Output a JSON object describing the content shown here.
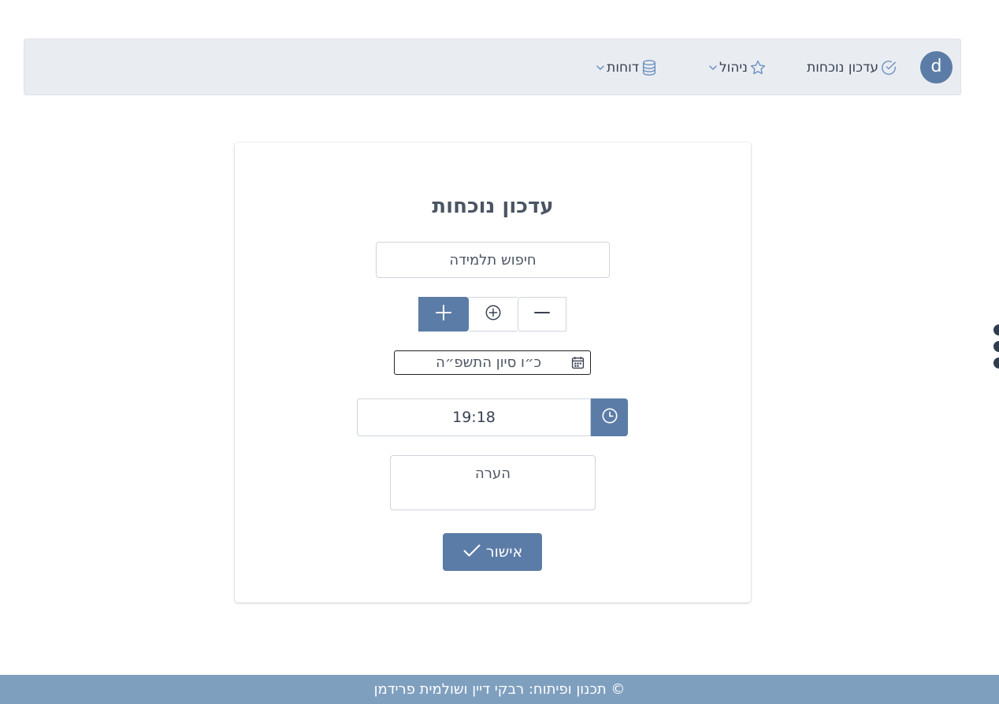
{
  "navbar": {
    "avatar_letter": "d",
    "items": [
      {
        "label": "עדכון נוכחות",
        "icon": "check-circle-icon",
        "has_dropdown": false
      },
      {
        "label": "ניהול",
        "icon": "star-icon",
        "has_dropdown": true
      },
      {
        "label": "דוחות",
        "icon": "database-icon",
        "has_dropdown": true
      }
    ]
  },
  "form": {
    "title": "עדכון נוכחות",
    "search_placeholder": "חיפוש תלמידה",
    "status_buttons": [
      {
        "icon": "plus-icon",
        "active": true
      },
      {
        "icon": "plus-circle-icon",
        "active": false
      },
      {
        "icon": "minus-icon",
        "active": false
      }
    ],
    "date_value": "כ״ו סיון התשפ״ה",
    "time_value": "19:18",
    "note_placeholder": "הערה",
    "confirm_label": "אישור"
  },
  "footer": {
    "text": "© תכנון ופיתוח: רבקי דיין ושולמית פרידמן"
  },
  "colors": {
    "primary": "#5b7ca7",
    "navbar_bg": "#e9ecf1",
    "footer_bg": "#7f9fbf",
    "side_dots": "#2f3e4e"
  }
}
